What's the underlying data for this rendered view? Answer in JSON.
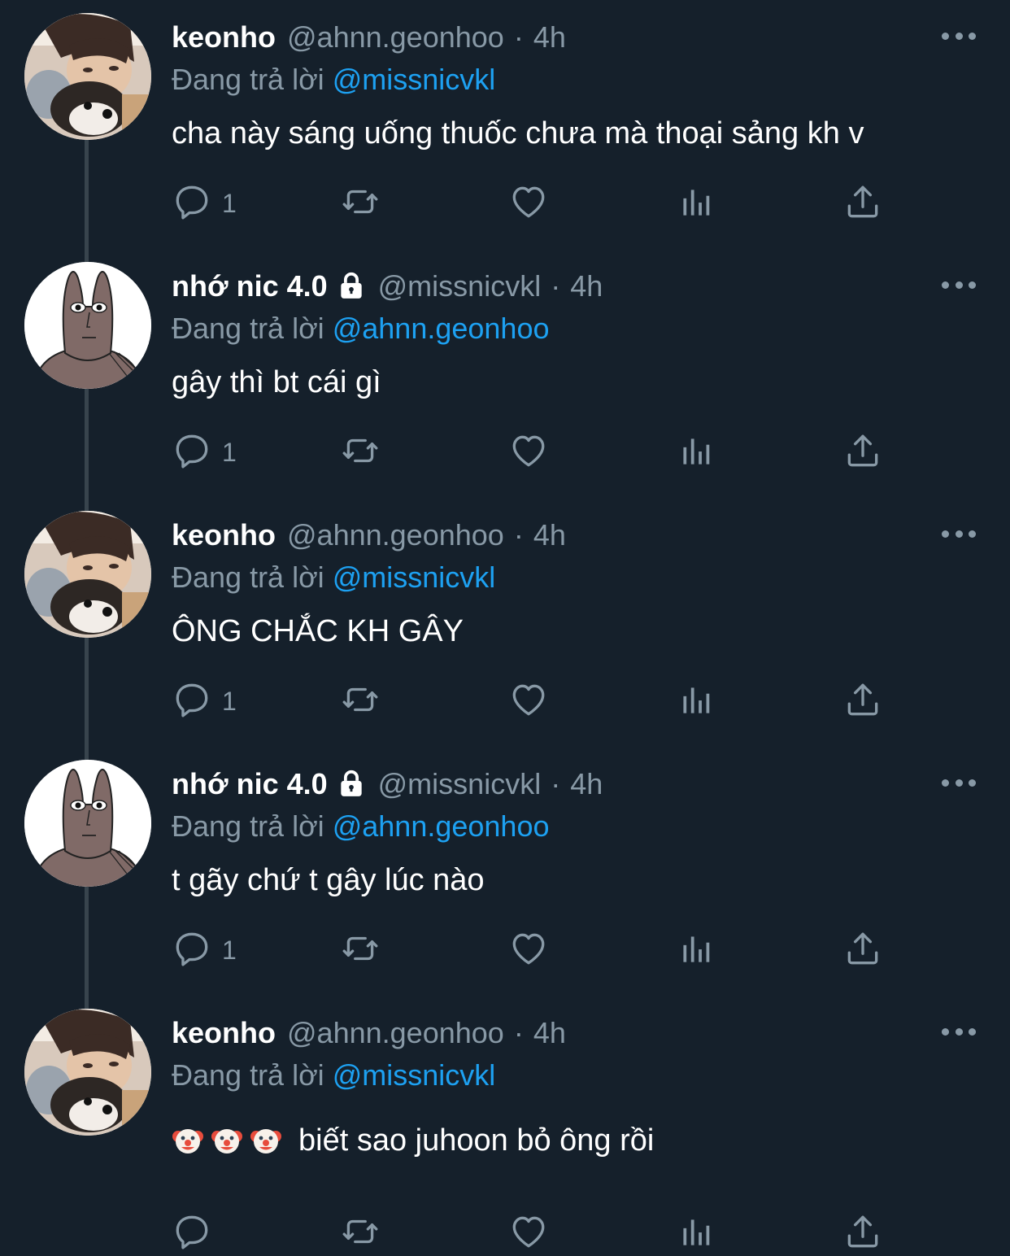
{
  "thread": {
    "tweets": [
      {
        "avatar": "boy-with-dog-photo",
        "name": "keonho",
        "locked": false,
        "handle": "@ahnn.geonhoo",
        "separator": "·",
        "time": "4h",
        "reply_prefix": "Đang trả lời",
        "reply_to": "@missnicvkl",
        "text": "cha này sáng uống thuốc chưa mà thoại sảng kh v",
        "emoji_prefix": [],
        "reply_count": "1"
      },
      {
        "avatar": "cartoon-rabbit",
        "name": "nhớ nic 4.0",
        "locked": true,
        "handle": "@missnicvkl",
        "separator": "·",
        "time": "4h",
        "reply_prefix": "Đang trả lời",
        "reply_to": "@ahnn.geonhoo",
        "text": "gây thì bt cái gì",
        "emoji_prefix": [],
        "reply_count": "1"
      },
      {
        "avatar": "boy-with-dog-photo",
        "name": "keonho",
        "locked": false,
        "handle": "@ahnn.geonhoo",
        "separator": "·",
        "time": "4h",
        "reply_prefix": "Đang trả lời",
        "reply_to": "@missnicvkl",
        "text": "ÔNG CHẮC KH GÂY",
        "emoji_prefix": [],
        "reply_count": "1"
      },
      {
        "avatar": "cartoon-rabbit",
        "name": "nhớ nic 4.0",
        "locked": true,
        "handle": "@missnicvkl",
        "separator": "·",
        "time": "4h",
        "reply_prefix": "Đang trả lời",
        "reply_to": "@ahnn.geonhoo",
        "text": "t gãy chứ t gây lúc nào",
        "emoji_prefix": [],
        "reply_count": "1"
      },
      {
        "avatar": "boy-with-dog-photo",
        "name": "keonho",
        "locked": false,
        "handle": "@ahnn.geonhoo",
        "separator": "·",
        "time": "4h",
        "reply_prefix": "Đang trả lời",
        "reply_to": "@missnicvkl",
        "text": "biết sao juhoon bỏ ông rồi",
        "emoji_prefix": [
          "clown-face-emoji",
          "clown-face-emoji",
          "clown-face-emoji"
        ],
        "reply_count": ""
      }
    ]
  },
  "colors": {
    "background": "#15202b",
    "primary_text": "#ffffff",
    "secondary_text": "#8899a6",
    "mention": "#1da1f2",
    "thread_line": "#38444d"
  },
  "icons": {
    "reply": "reply-icon",
    "retweet": "retweet-icon",
    "like": "like-icon",
    "analytics": "analytics-icon",
    "share": "share-icon",
    "more": "more-icon",
    "lock": "lock-icon"
  }
}
